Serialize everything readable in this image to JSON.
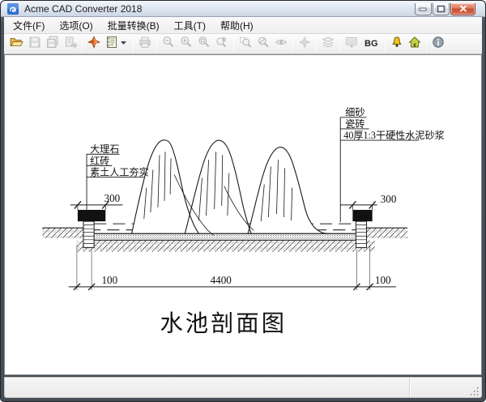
{
  "window": {
    "title": "Acme CAD Converter 2018"
  },
  "colors": {
    "close_button": "#c64e33",
    "titlebar": "#dde5f0",
    "folder_icon": "#f0c362",
    "convert_star_icon": "#e05a10",
    "home_icon": "#c8ce44",
    "alarm_icon": "#f5c518"
  },
  "menubar": {
    "items": [
      {
        "label": "文件(F)"
      },
      {
        "label": "选项(O)"
      },
      {
        "label": "批量转换(B)"
      },
      {
        "label": "工具(T)"
      },
      {
        "label": "帮助(H)"
      }
    ]
  },
  "toolbar": {
    "bg_label": "BG",
    "buttons": [
      {
        "name": "open-file",
        "icon": "open-folder-icon",
        "enabled": true
      },
      {
        "name": "save",
        "icon": "floppy-icon",
        "enabled": false
      },
      {
        "name": "save-copy",
        "icon": "floppy-copy-icon",
        "enabled": false
      },
      {
        "name": "batch-export",
        "icon": "export-pages-icon",
        "enabled": false
      },
      {
        "name": "convert",
        "icon": "red-star-icon",
        "enabled": true
      },
      {
        "name": "export-format",
        "icon": "notebook-caret-icon",
        "enabled": true
      },
      {
        "name": "print",
        "icon": "printer-icon",
        "enabled": false
      },
      {
        "name": "zoom-out",
        "icon": "magnifier-minus-icon",
        "enabled": false
      },
      {
        "name": "zoom-in",
        "icon": "magnifier-plus-icon",
        "enabled": false
      },
      {
        "name": "zoom-extents",
        "icon": "magnifier-e-icon",
        "enabled": false
      },
      {
        "name": "zoom-window",
        "icon": "magnifier-cursor-icon",
        "enabled": false
      },
      {
        "name": "zoom-selection",
        "icon": "magnifier-box-icon",
        "enabled": false
      },
      {
        "name": "zoom-previous",
        "icon": "magnifier-slash-icon",
        "enabled": false
      },
      {
        "name": "view-eye",
        "icon": "eye-icon",
        "enabled": false
      },
      {
        "name": "plugin",
        "icon": "gray-star-icon",
        "enabled": false
      },
      {
        "name": "layers",
        "icon": "layers-icon",
        "enabled": false
      },
      {
        "name": "display",
        "icon": "monitor-icon",
        "enabled": false
      },
      {
        "name": "background-color",
        "icon": "bg-text",
        "enabled": true
      },
      {
        "name": "notification",
        "icon": "bell-icon",
        "enabled": true
      },
      {
        "name": "homepage",
        "icon": "home-icon",
        "enabled": true
      },
      {
        "name": "about",
        "icon": "info-icon",
        "enabled": true
      }
    ]
  },
  "drawing": {
    "left_labels": [
      "大理石",
      "红砖",
      "素土人工夯实"
    ],
    "right_labels": [
      "细砂",
      "瓷砖",
      "40厚1:3干硬性水泥砂浆"
    ],
    "dims": {
      "left_coping": "300",
      "right_coping": "300",
      "left_wall": "100",
      "pool_span": "4400",
      "right_wall": "100"
    },
    "caption": "水池剖面图"
  },
  "statusbar": {
    "left": "",
    "right": ""
  }
}
